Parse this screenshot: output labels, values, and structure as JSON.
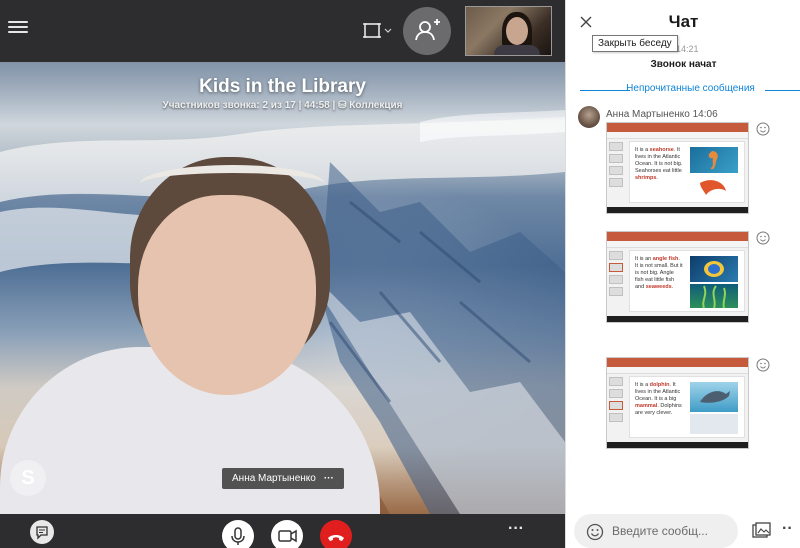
{
  "call": {
    "title": "Kids in the Library",
    "subtitle": "Участников звонка: 2 из 17 | 44:58 | ⛁ Коллекция",
    "participant_name": "Анна Мартыненко",
    "participant_more": "···",
    "skype_letter": "S",
    "more_label": "···"
  },
  "icons": {
    "menu": "hamburger-menu-icon",
    "layout": "layout-switch-icon",
    "add_person": "add-person-icon",
    "chat": "chat-bubble-icon",
    "mic": "microphone-icon",
    "video": "video-camera-icon",
    "end": "end-call-icon",
    "close": "close-icon",
    "emoji": "smiley-icon",
    "gallery": "gallery-icon"
  },
  "colors": {
    "end_call": "#e01e1e",
    "accent": "#0f84d9",
    "ribbon": "#c55a3c"
  },
  "chat": {
    "title": "Чат",
    "close_tooltip": "Закрыть беседу",
    "tooltip_tail": "14:21",
    "call_started": "Звонок начат",
    "unread": "Непрочитанные сообщения",
    "sender": "Анна Мартыненко 14:06",
    "input_placeholder": "Введите сообщ...",
    "more_label": "··"
  },
  "slides": [
    {
      "t1": "It is a ",
      "hl1": "seahorse",
      "t2": ". It lives in the Atlantic Ocean. It is not big. Seahorses eat little ",
      "hl2": "shrimps",
      "t3": "."
    },
    {
      "t1": "It is an ",
      "hl1": "angle fish",
      "t2": ". It is not small. But it is not big. Angle fish eat little fish and ",
      "hl2": "seaweeds",
      "t3": "."
    },
    {
      "t1": "It is a ",
      "hl1": "dolphin",
      "t2": ". It lives in the Atlantic Ocean. It is a big ",
      "hl2": "mammal",
      "t3": ". Dolphins are very clever."
    }
  ]
}
